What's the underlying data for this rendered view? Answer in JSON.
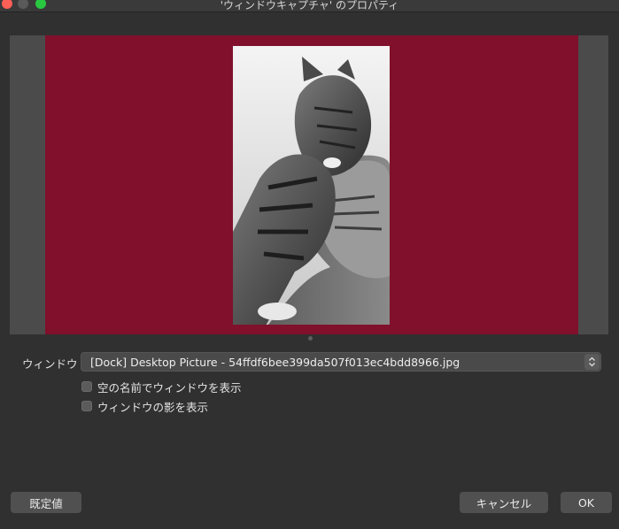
{
  "window": {
    "title": "'ウィンドウキャプチャ' のプロパティ"
  },
  "form": {
    "window_label": "ウィンドウ",
    "window_value": "[Dock] Desktop Picture - 54ffdf6bee399da507f013ec4bdd8966.jpg",
    "checkboxes": [
      {
        "label": "空の名前でウィンドウを表示",
        "checked": false
      },
      {
        "label": "ウィンドウの影を表示",
        "checked": false
      }
    ]
  },
  "buttons": {
    "defaults": "既定値",
    "cancel": "キャンセル",
    "ok": "OK"
  },
  "colors": {
    "background": "#303030",
    "preview_bg": "#4b4b4b",
    "canvas": "#80102b"
  }
}
